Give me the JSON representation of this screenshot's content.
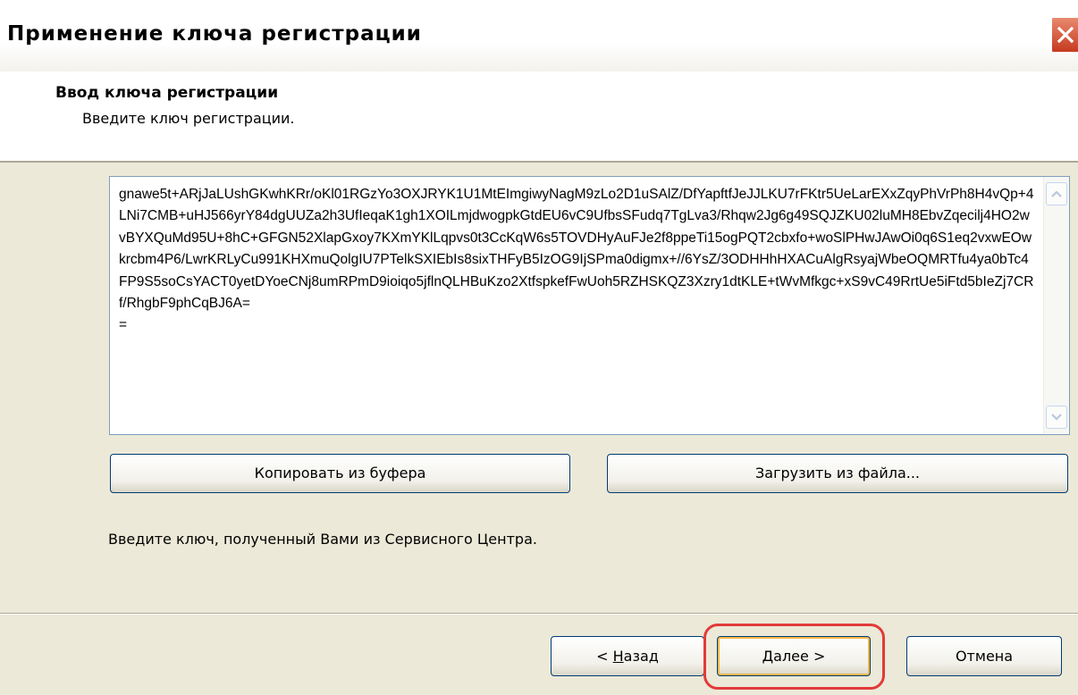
{
  "window": {
    "title": "Применение ключа регистрации",
    "close_icon": "close-icon"
  },
  "header": {
    "title": "Ввод ключа регистрации",
    "subtitle": "Введите ключ регистрации."
  },
  "key_field": {
    "value": "gnawe5t+ARjJaLUshGKwhKRr/oKl01RGzYo3OXJRYK1U1MtEImgiwyNagM9zLo2D1uSAlZ/DfYapftfJeJJLKU7rFKtr5UeLarEXxZqyPhVrPh8H4vQp+4LNi7CMB+uHJ566yrY84dgUUZa2h3UfIeqaK1gh1XOILmjdwogpkGtdEU6vC9UfbsSFudq7TgLva3/Rhqw2Jg6g49SQJZKU02luMH8EbvZqecilj4HO2wvBYXQuMd95U+8hC+GFGN52XlapGxoy7KXmYKlLqpvs0t3CcKqW6s5TOVDHyAuFJe2f8ppeTi15ogPQT2cbxfo+woSlPHwJAwOi0q6S1eq2vxwEOwkrcbm4P6/LwrKRLyCu991KHXmuQolgIU7PTelkSXIEbIs8sixTHFyB5IzOG9IjSPma0digmx+//6YsZ/3ODHHhHXACuAlgRsyajWbeOQMRTfu4ya0bTc4FP9S5soCsYACT0yetDYoeCNj8umRPmD9ioiqo5jflnQLHBuKzo2XtfspkefFwUoh5RZHSKQZ3Xzry1dtKLE+tWvMfkgc+xS9vC49RrtUe5iFtd5bIeZj7CRf/RhgbF9phCqBJ6A=\n="
  },
  "buttons": {
    "copy_label": "Копировать из буфера",
    "load_label": "Загрузить из файла...",
    "back_prefix": "< ",
    "back_accel": "Н",
    "back_rest": "азад",
    "next_accel": "Д",
    "next_rest": "алее >",
    "cancel_label": "Отмена"
  },
  "hint": "Введите ключ, полученный Вами из Сервисного Центра.",
  "colors": {
    "dialog_bg": "#ece9d8",
    "highlight": "#e23a3a",
    "close_button": "#c63a20"
  }
}
